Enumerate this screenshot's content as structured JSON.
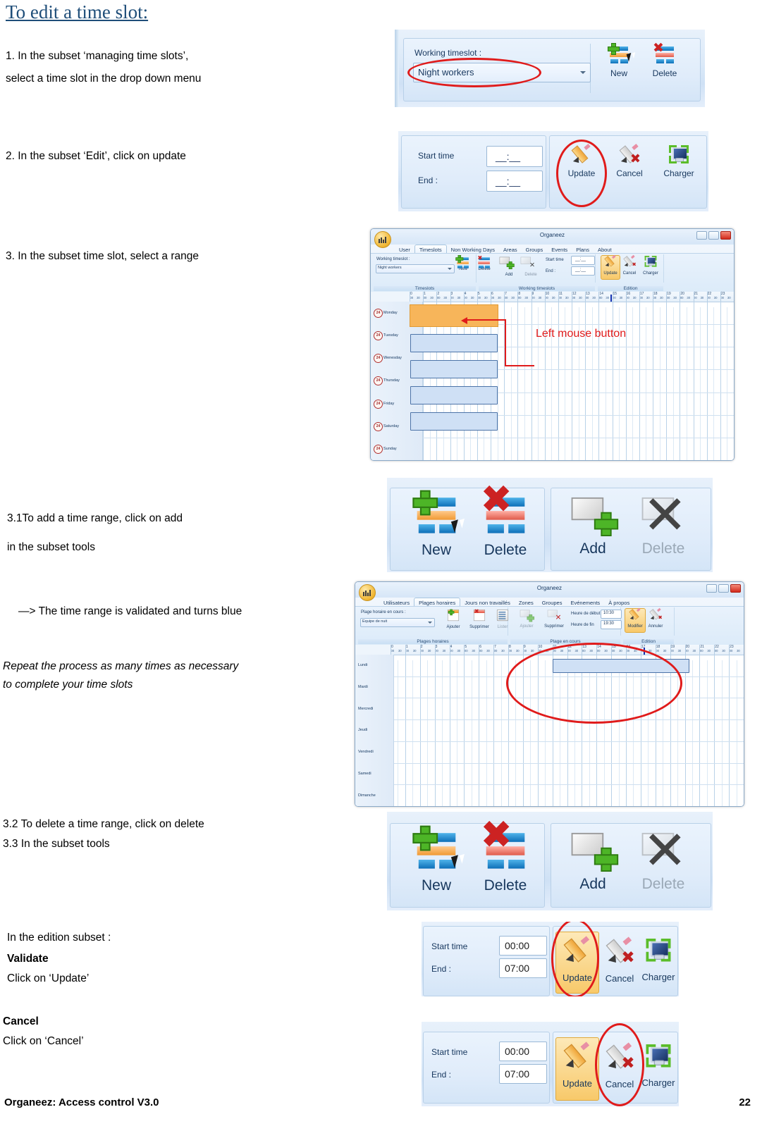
{
  "document": {
    "title": "To edit a time slot:",
    "footer_left": "Organeez: Access control     V3.0",
    "footer_page": "22"
  },
  "steps": {
    "s1_line1": "1. In the subset ‘managing time slots’,",
    "s1_line2": " select a time slot in the drop down menu",
    "s2": "2. In the subset ‘Edit’, click on update",
    "s3": "3. In the subset time slot, select a range",
    "s31_line1": "3.1To add a time range, click on add",
    "s31_line2": "in the subset tools",
    "s31_result": "—> The time range is validated and turns blue",
    "repeat_line1": "Repeat the process as many times as necessary",
    "repeat_line2": "to complete your time slots",
    "s32": "3.2 To delete a time range, click on delete",
    "s33": "3.3 In the subset tools",
    "edition_intro": "In the edition subset :",
    "validate_title": "Validate",
    "validate_text": "Click on ‘Update’",
    "cancel_title": "Cancel",
    "cancel_text": "Click on ‘Cancel’"
  },
  "shot1": {
    "label": "Working timeslot :",
    "combo_value": "Night workers",
    "new_label": "New",
    "delete_label": "Delete"
  },
  "shot2": {
    "start_label": "Start time",
    "end_label": "End :",
    "start_value": "__:__",
    "end_value": "__:__",
    "update_label": "Update",
    "cancel_label": "Cancel",
    "charger_label": "Charger"
  },
  "app_en": {
    "window_title": "Organeez",
    "tabs": [
      "User",
      "Timeslots",
      "Non Working Days",
      "Areas",
      "Groups",
      "Events",
      "Plans",
      "About"
    ],
    "active_tab": "Timeslots",
    "combo_label": "Working timeslot :",
    "combo_value": "Night workers",
    "new_label": "New",
    "delete_label": "Delete",
    "add_label": "Add",
    "delete2_label": "Delete",
    "start_label": "Start time",
    "end_label": "End :",
    "start_value": "__:__",
    "end_value": "__:__",
    "update_label": "Update",
    "cancel_label": "Cancel",
    "charger_label": "Charger",
    "group_captions": [
      "Timeslots",
      "Working timeslots",
      "Edition"
    ],
    "days": [
      "Monday",
      "Tuesday",
      "Wenesday",
      "Thursday",
      "Friday",
      "Saturday",
      "Sunday"
    ],
    "day_badge": "24",
    "hours": [
      "0",
      "1",
      "2",
      "3",
      "4",
      "5",
      "6",
      "7",
      "8",
      "9",
      "10",
      "11",
      "12",
      "13",
      "14",
      "15",
      "16",
      "17",
      "18",
      "19",
      "20",
      "21",
      "22",
      "23"
    ],
    "half_labels": [
      "00",
      "30"
    ],
    "annotation": "Left mouse button"
  },
  "app_fr": {
    "window_title": "Organeez",
    "tabs": [
      "Utilisateurs",
      "Plages horaires",
      "Jours non travaillés",
      "Zones",
      "Groupes",
      "Evénements",
      "À propos"
    ],
    "active_tab": "Plages horaires",
    "combo_label": "Plage horaire en cours :",
    "combo_value": "Equipe de nuit",
    "add_label": "Ajouter",
    "delete_label": "Supprimer",
    "list_label": "Lister",
    "add2_label": "Ajouter",
    "delete2_label": "Supprimer",
    "start_label": "Heure de début",
    "end_label": "Heure de fin",
    "start_value": "10:30",
    "end_value": "19:30",
    "modify_label": "Modifier",
    "annuler_label": "Annuler",
    "group_captions": [
      "Plages horaires",
      "Plage en cours",
      "Edition"
    ],
    "days": [
      "Lundi",
      "Mardi",
      "Mercredi",
      "Jeudi",
      "Vendredi",
      "Samedi",
      "Dimanche"
    ],
    "hours": [
      "0",
      "1",
      "2",
      "3",
      "4",
      "5",
      "6",
      "7",
      "8",
      "9",
      "10",
      "11",
      "12",
      "13",
      "14",
      "15",
      "16",
      "17",
      "18",
      "19",
      "20",
      "21",
      "22",
      "23"
    ],
    "half_labels": [
      "00",
      "30"
    ]
  },
  "shot_tools": {
    "new_label": "New",
    "delete_label": "Delete",
    "add_label": "Add",
    "delete2_label": "Delete"
  },
  "shot_edit_update": {
    "start_label": "Start time",
    "end_label": "End :",
    "start_value": "00:00",
    "end_value": "07:00",
    "update_label": "Update",
    "cancel_label": "Cancel",
    "charger_label": "Charger"
  },
  "shot_edit_cancel": {
    "start_label": "Start time",
    "end_label": "End :",
    "start_value": "00:00",
    "end_value": "07:00",
    "update_label": "Update",
    "cancel_label": "Cancel",
    "charger_label": "Charger"
  },
  "colors": {
    "title_blue": "#1f4e79",
    "annotation_red": "#e01b1b",
    "selection_orange": "#f7b55a",
    "selection_blue": "#cfe0f5"
  }
}
